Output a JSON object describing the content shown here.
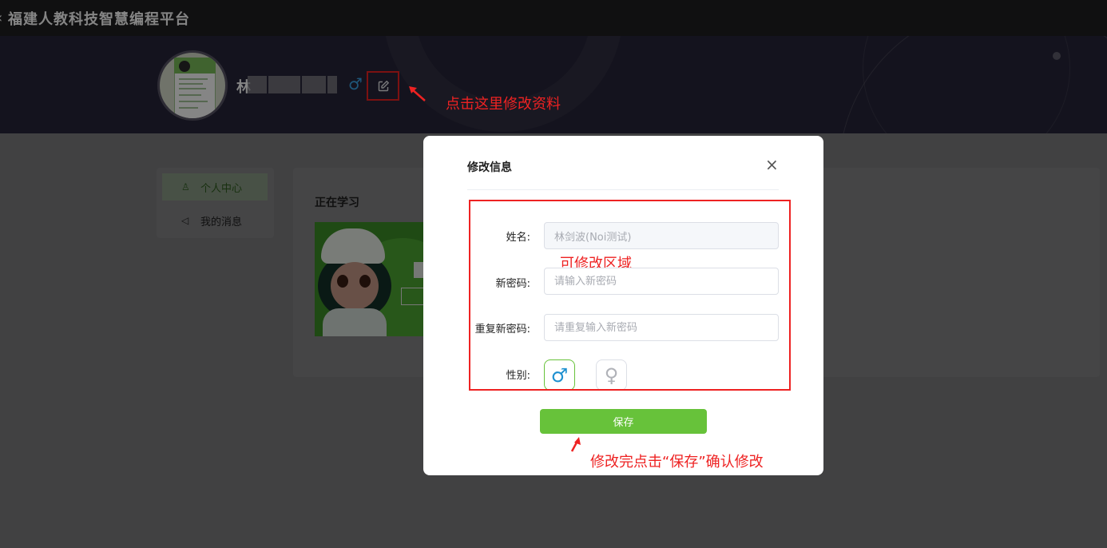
{
  "app": {
    "back_icon": "‹",
    "title": "福建人教科技智慧编程平台"
  },
  "profile": {
    "name_initial": "林",
    "gender_symbol": "♂",
    "edit_icon": "edit-icon"
  },
  "annotations": {
    "edit_hint": "点击这里修改资料",
    "region_hint": "可修改区域",
    "save_hint": "修改完点击“保存”确认修改"
  },
  "side_menu": {
    "items": [
      {
        "icon": "user-icon",
        "label": "个人中心"
      },
      {
        "icon": "megaphone-icon",
        "label": "我的消息"
      }
    ]
  },
  "learning": {
    "heading": "正在学习"
  },
  "modal": {
    "title": "修改信息",
    "close": "×",
    "fields": {
      "name_label": "姓名:",
      "name_value": "林剑波(Noi测试)",
      "new_pwd_label": "新密码:",
      "new_pwd_placeholder": "请输入新密码",
      "repeat_pwd_label": "重复新密码:",
      "repeat_pwd_placeholder": "请重复输入新密码",
      "gender_label": "性别:",
      "male_symbol": "♂",
      "female_symbol": "♀"
    },
    "save_label": "保存"
  },
  "colors": {
    "accent": "#67c23a",
    "annotation": "#ee2222",
    "male": "#1e90d0"
  }
}
